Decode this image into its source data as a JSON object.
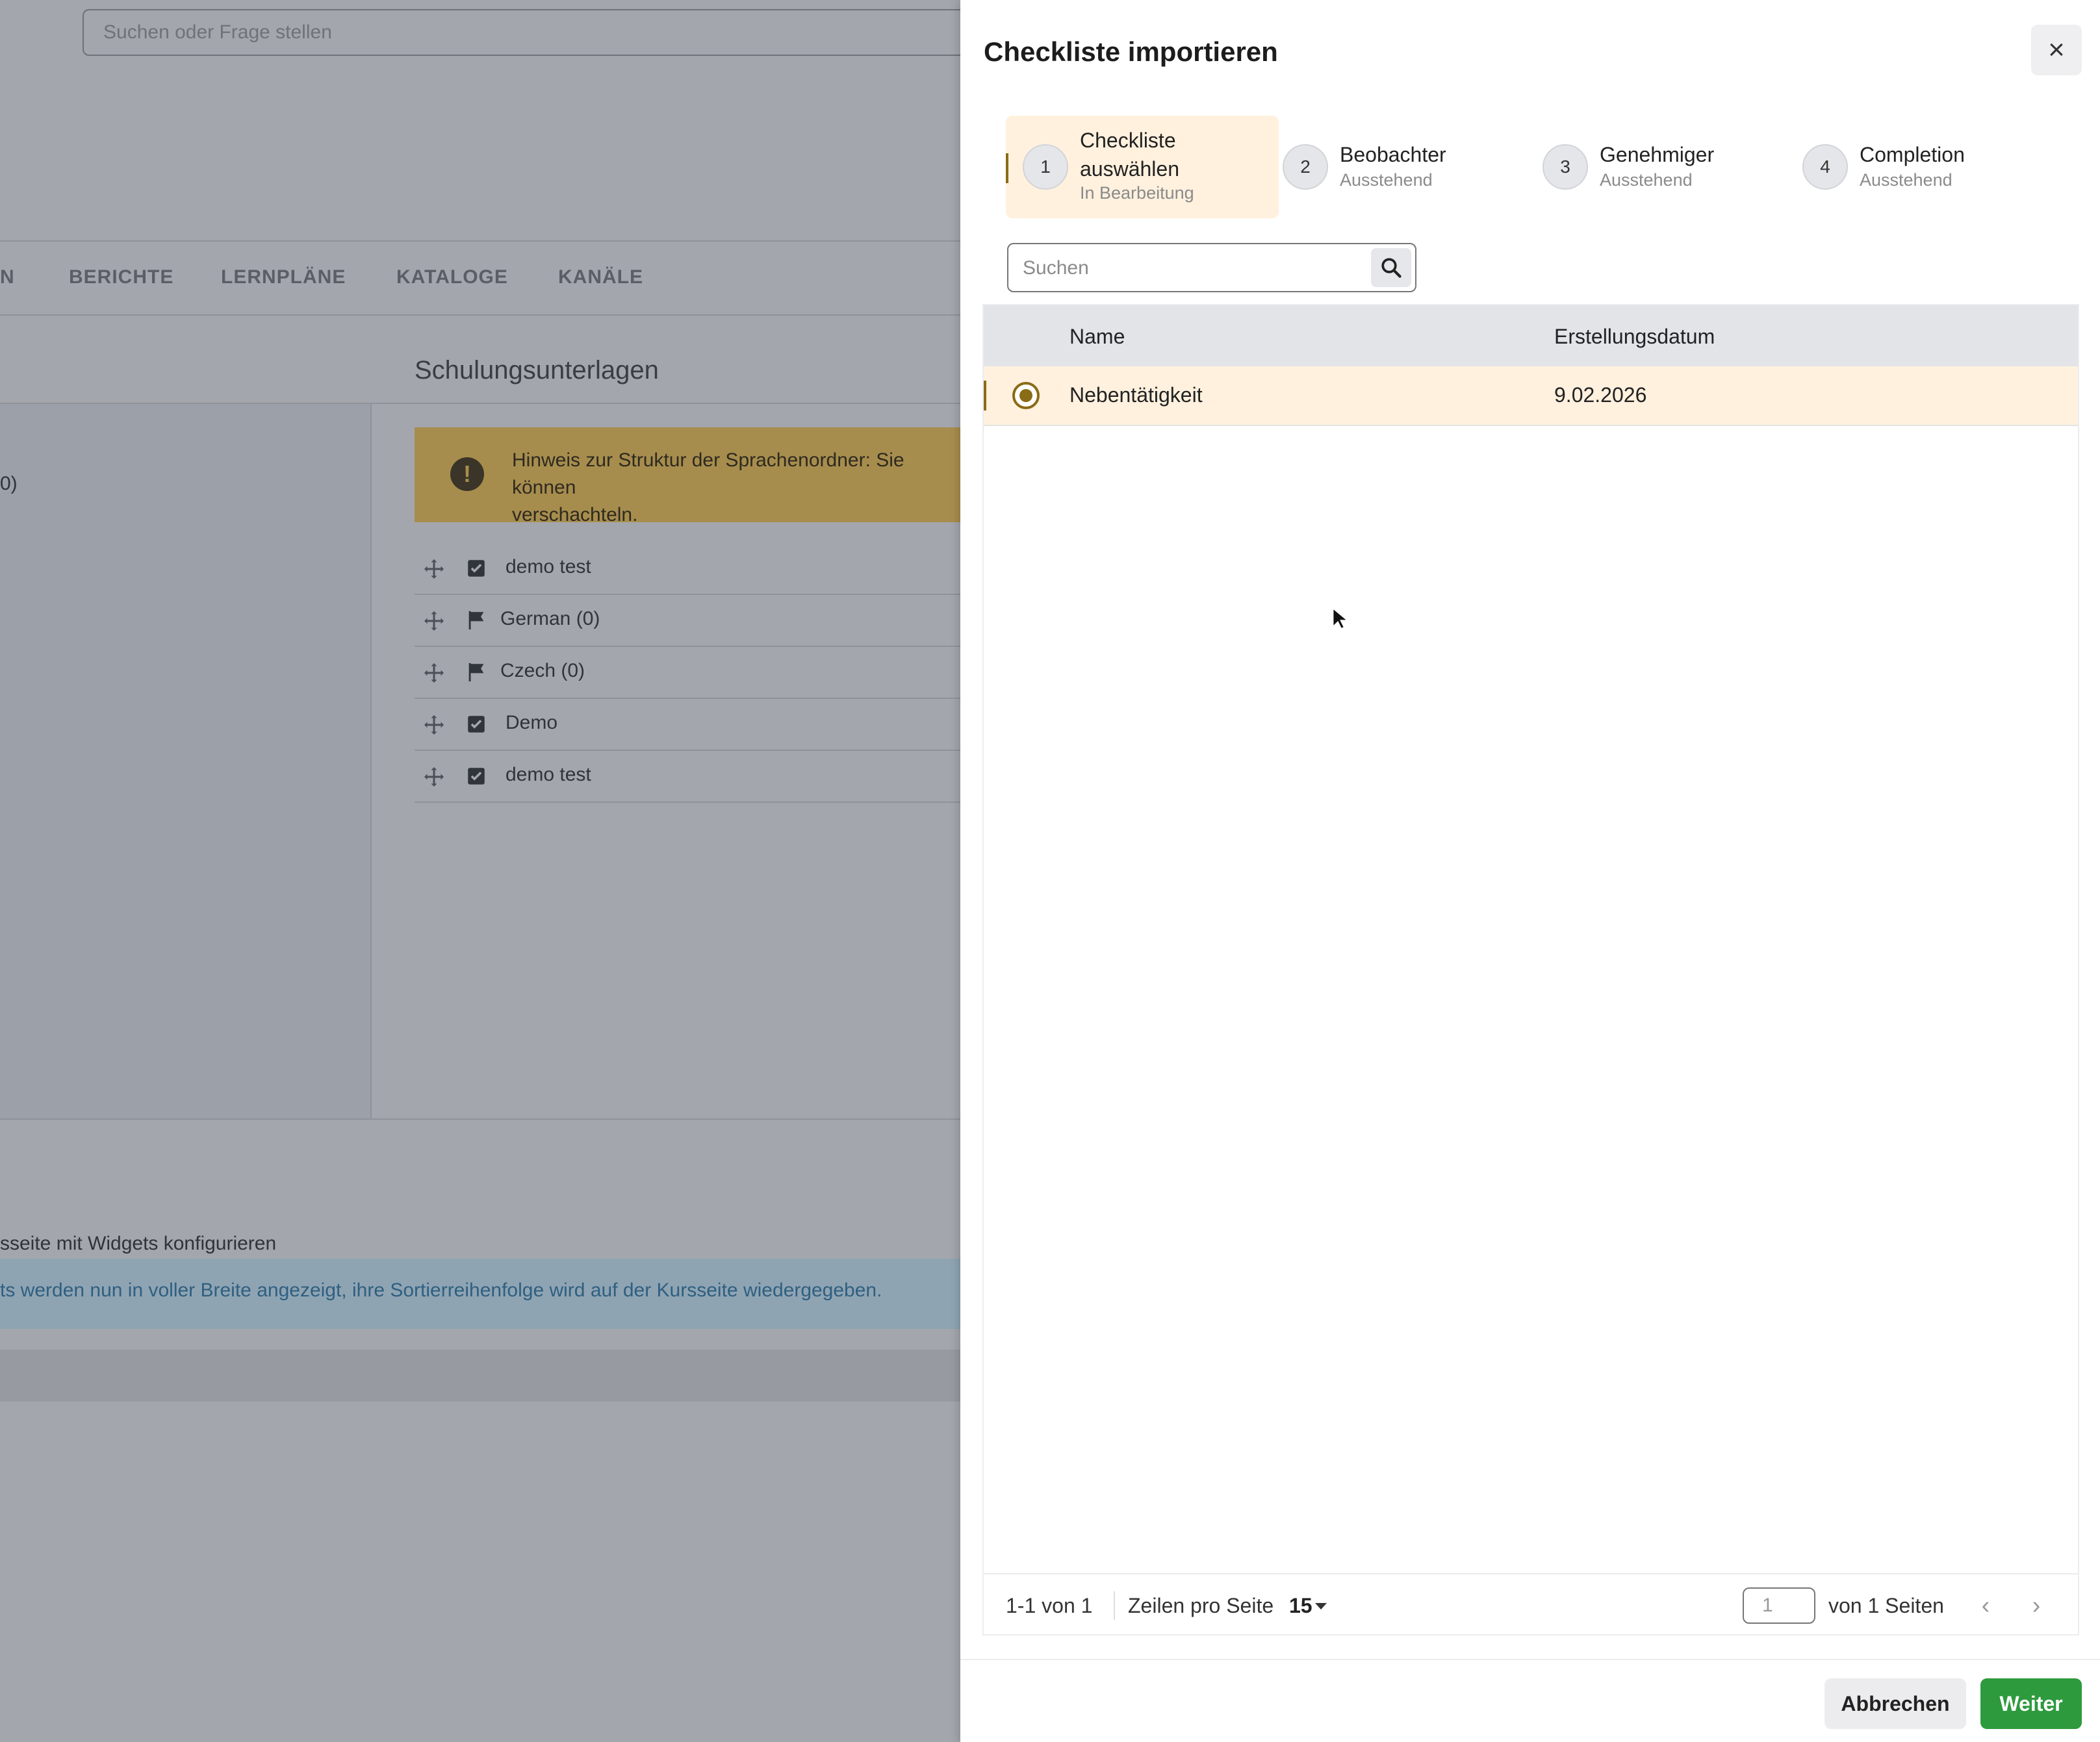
{
  "background": {
    "search_placeholder": "Suchen oder Frage stellen",
    "nav_tabs": [
      "N",
      "BERICHTE",
      "LERNPLÄNE",
      "KATALOGE",
      "KANÄLE"
    ],
    "heading": "Schulungsunterlagen",
    "side_text": "0)",
    "warning_text_line1": "Hinweis zur Struktur der Sprachenordner: Sie können",
    "warning_text_line2": "verschachteln.",
    "items": [
      {
        "label": "demo test",
        "icon": "checkbox-icon"
      },
      {
        "label": "German (0)",
        "icon": "flag-icon"
      },
      {
        "label": "Czech (0)",
        "icon": "flag-icon"
      },
      {
        "label": "Demo",
        "icon": "checkbox-icon"
      },
      {
        "label": "demo test",
        "icon": "checkbox-icon"
      }
    ],
    "widgets_text": "sseite mit Widgets konfigurieren",
    "info_text": "ts werden nun in voller Breite angezeigt, ihre Sortierreihenfolge wird auf der Kursseite wiedergegeben."
  },
  "dialog": {
    "title": "Checkliste importieren",
    "close_icon": "×",
    "steps": [
      {
        "num": "1",
        "label": "Checkliste auswählen",
        "status": "In Bearbeitung"
      },
      {
        "num": "2",
        "label": "Beobachter",
        "status": "Ausstehend"
      },
      {
        "num": "3",
        "label": "Genehmiger",
        "status": "Ausstehend"
      },
      {
        "num": "4",
        "label": "Completion",
        "status": "Ausstehend"
      }
    ],
    "search_placeholder": "Suchen",
    "table": {
      "columns": [
        "Name",
        "Erstellungsdatum"
      ],
      "rows": [
        {
          "name": "Nebentätigkeit",
          "date": "9.02.2026",
          "selected": true
        }
      ]
    },
    "footer": {
      "range": "1-1 von 1",
      "rows_per_page_label": "Zeilen pro Seite",
      "rows_per_page": "15",
      "page": "1",
      "pages_label": "von 1 Seiten",
      "prev": "‹",
      "next": "›"
    },
    "cancel_label": "Abbrechen",
    "next_label": "Weiter"
  },
  "colors": {
    "accent": "#8a6b16",
    "selected_bg": "#fff1de",
    "primary_button": "#2e9a3e"
  }
}
